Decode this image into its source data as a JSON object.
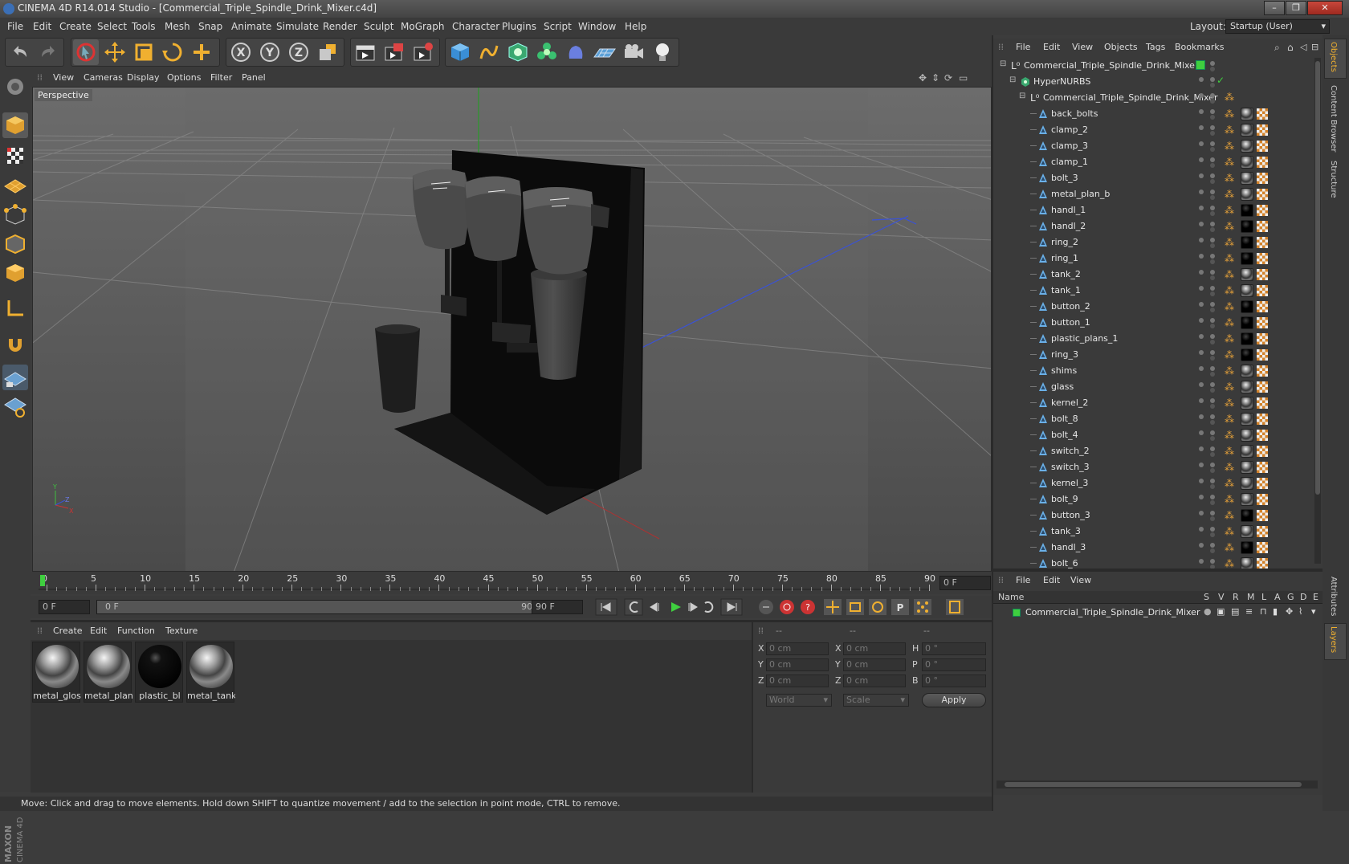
{
  "window": {
    "title": "CINEMA 4D R14.014 Studio - [Commercial_Triple_Spindle_Drink_Mixer.c4d]",
    "controls": [
      "–",
      "❐",
      "✕"
    ]
  },
  "menubar": {
    "items": [
      "File",
      "Edit",
      "Create",
      "Select",
      "Tools",
      "Mesh",
      "Snap",
      "Animate",
      "Simulate",
      "Render",
      "Sculpt",
      "MoGraph",
      "Character",
      "Plugins",
      "Script",
      "Window",
      "Help"
    ],
    "layout_label": "Layout:",
    "layout_value": "Startup (User)"
  },
  "viewport": {
    "menu": [
      "View",
      "Cameras",
      "Display",
      "Options",
      "Filter",
      "Panel"
    ],
    "label": "Perspective"
  },
  "timeline": {
    "ticks": [
      "0",
      "5",
      "10",
      "15",
      "20",
      "25",
      "30",
      "35",
      "40",
      "45",
      "50",
      "55",
      "60",
      "65",
      "70",
      "75",
      "80",
      "85",
      "90"
    ],
    "current_frame": "0 F"
  },
  "transport": {
    "start_field": "0 F",
    "range_start": "0 F",
    "range_end": "90 F",
    "end_field": "90 F"
  },
  "materials": {
    "menu": [
      "Create",
      "Edit",
      "Function",
      "Texture"
    ],
    "items": [
      {
        "name": "metal_glos",
        "kind": "chrome"
      },
      {
        "name": "metal_plan",
        "kind": "chrome"
      },
      {
        "name": "plastic_bl",
        "kind": "black"
      },
      {
        "name": "metal_tank",
        "kind": "chrome"
      }
    ]
  },
  "coordinates": {
    "headers": [
      "--",
      "--",
      "--"
    ],
    "rows": [
      {
        "a": "X",
        "av": "0 cm",
        "b": "X",
        "bv": "0 cm",
        "c": "H",
        "cv": "0 °"
      },
      {
        "a": "Y",
        "av": "0 cm",
        "b": "Y",
        "bv": "0 cm",
        "c": "P",
        "cv": "0 °"
      },
      {
        "a": "Z",
        "av": "0 cm",
        "b": "Z",
        "bv": "0 cm",
        "c": "B",
        "cv": "0 °"
      }
    ],
    "mode": "World",
    "scale": "Scale",
    "apply": "Apply"
  },
  "objects": {
    "menu": [
      "File",
      "Edit",
      "View",
      "Objects",
      "Tags",
      "Bookmarks"
    ],
    "root": "Commercial_Triple_Spindle_Drink_Mixer",
    "hypernurbs": "HyperNURBS",
    "group": "Commercial_Triple_Spindle_Drink_Mixer",
    "children": [
      {
        "name": "back_bolts",
        "mat": "chrome"
      },
      {
        "name": "clamp_2",
        "mat": "chrome"
      },
      {
        "name": "clamp_3",
        "mat": "chrome"
      },
      {
        "name": "clamp_1",
        "mat": "chrome"
      },
      {
        "name": "bolt_3",
        "mat": "chrome"
      },
      {
        "name": "metal_plan_b",
        "mat": "chrome"
      },
      {
        "name": "handl_1",
        "mat": "black"
      },
      {
        "name": "handl_2",
        "mat": "black"
      },
      {
        "name": "ring_2",
        "mat": "black"
      },
      {
        "name": "ring_1",
        "mat": "black"
      },
      {
        "name": "tank_2",
        "mat": "chrome"
      },
      {
        "name": "tank_1",
        "mat": "chrome"
      },
      {
        "name": "button_2",
        "mat": "black"
      },
      {
        "name": "button_1",
        "mat": "black"
      },
      {
        "name": "plastic_plans_1",
        "mat": "black"
      },
      {
        "name": "ring_3",
        "mat": "black"
      },
      {
        "name": "shims",
        "mat": "chrome"
      },
      {
        "name": "glass",
        "mat": "chrome"
      },
      {
        "name": "kernel_2",
        "mat": "chrome"
      },
      {
        "name": "bolt_8",
        "mat": "chrome"
      },
      {
        "name": "bolt_4",
        "mat": "chrome"
      },
      {
        "name": "switch_2",
        "mat": "chrome"
      },
      {
        "name": "switch_3",
        "mat": "chrome"
      },
      {
        "name": "kernel_3",
        "mat": "chrome"
      },
      {
        "name": "bolt_9",
        "mat": "chrome"
      },
      {
        "name": "button_3",
        "mat": "black"
      },
      {
        "name": "tank_3",
        "mat": "chrome"
      },
      {
        "name": "handl_3",
        "mat": "black"
      },
      {
        "name": "bolt_6",
        "mat": "chrome"
      }
    ]
  },
  "layers": {
    "menu": [
      "File",
      "Edit",
      "View"
    ],
    "columns": [
      "Name",
      "S",
      "V",
      "R",
      "M",
      "L",
      "A",
      "G",
      "D",
      "E"
    ],
    "row": "Commercial_Triple_Spindle_Drink_Mixer"
  },
  "side_tabs": [
    "Objects",
    "Content Browser",
    "Structure"
  ],
  "side_tabs_bottom": [
    "Attributes",
    "Layers"
  ],
  "status": "Move: Click and drag to move elements. Hold down SHIFT to quantize movement / add to the selection in point mode, CTRL to remove.",
  "colors": {
    "accent_orange": "#e8a33a",
    "axis_green": "#3fbf3f",
    "axis_blue": "#3a52d6",
    "axis_red": "#cc3333",
    "layer_green": "#3fcf3f"
  }
}
